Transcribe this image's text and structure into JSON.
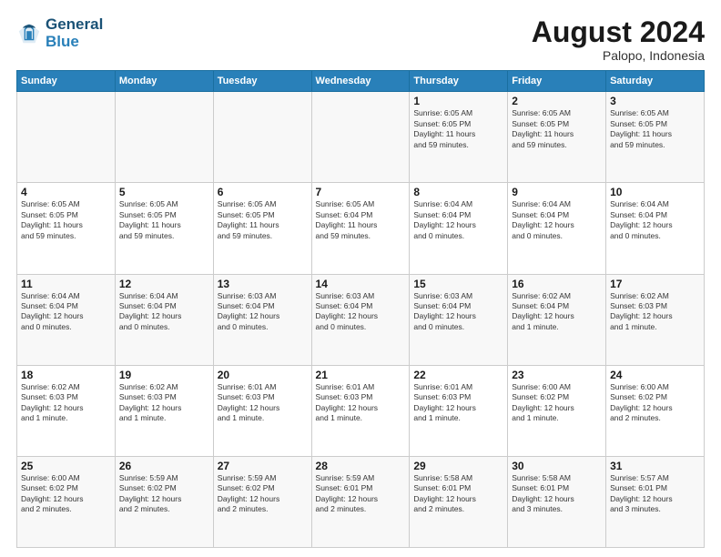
{
  "header": {
    "logo_line1": "General",
    "logo_line2": "Blue",
    "main_title": "August 2024",
    "subtitle": "Palopo, Indonesia"
  },
  "calendar": {
    "days_of_week": [
      "Sunday",
      "Monday",
      "Tuesday",
      "Wednesday",
      "Thursday",
      "Friday",
      "Saturday"
    ],
    "weeks": [
      [
        {
          "day": "",
          "info": ""
        },
        {
          "day": "",
          "info": ""
        },
        {
          "day": "",
          "info": ""
        },
        {
          "day": "",
          "info": ""
        },
        {
          "day": "1",
          "info": "Sunrise: 6:05 AM\nSunset: 6:05 PM\nDaylight: 11 hours\nand 59 minutes."
        },
        {
          "day": "2",
          "info": "Sunrise: 6:05 AM\nSunset: 6:05 PM\nDaylight: 11 hours\nand 59 minutes."
        },
        {
          "day": "3",
          "info": "Sunrise: 6:05 AM\nSunset: 6:05 PM\nDaylight: 11 hours\nand 59 minutes."
        }
      ],
      [
        {
          "day": "4",
          "info": "Sunrise: 6:05 AM\nSunset: 6:05 PM\nDaylight: 11 hours\nand 59 minutes."
        },
        {
          "day": "5",
          "info": "Sunrise: 6:05 AM\nSunset: 6:05 PM\nDaylight: 11 hours\nand 59 minutes."
        },
        {
          "day": "6",
          "info": "Sunrise: 6:05 AM\nSunset: 6:05 PM\nDaylight: 11 hours\nand 59 minutes."
        },
        {
          "day": "7",
          "info": "Sunrise: 6:05 AM\nSunset: 6:04 PM\nDaylight: 11 hours\nand 59 minutes."
        },
        {
          "day": "8",
          "info": "Sunrise: 6:04 AM\nSunset: 6:04 PM\nDaylight: 12 hours\nand 0 minutes."
        },
        {
          "day": "9",
          "info": "Sunrise: 6:04 AM\nSunset: 6:04 PM\nDaylight: 12 hours\nand 0 minutes."
        },
        {
          "day": "10",
          "info": "Sunrise: 6:04 AM\nSunset: 6:04 PM\nDaylight: 12 hours\nand 0 minutes."
        }
      ],
      [
        {
          "day": "11",
          "info": "Sunrise: 6:04 AM\nSunset: 6:04 PM\nDaylight: 12 hours\nand 0 minutes."
        },
        {
          "day": "12",
          "info": "Sunrise: 6:04 AM\nSunset: 6:04 PM\nDaylight: 12 hours\nand 0 minutes."
        },
        {
          "day": "13",
          "info": "Sunrise: 6:03 AM\nSunset: 6:04 PM\nDaylight: 12 hours\nand 0 minutes."
        },
        {
          "day": "14",
          "info": "Sunrise: 6:03 AM\nSunset: 6:04 PM\nDaylight: 12 hours\nand 0 minutes."
        },
        {
          "day": "15",
          "info": "Sunrise: 6:03 AM\nSunset: 6:04 PM\nDaylight: 12 hours\nand 0 minutes."
        },
        {
          "day": "16",
          "info": "Sunrise: 6:02 AM\nSunset: 6:04 PM\nDaylight: 12 hours\nand 1 minute."
        },
        {
          "day": "17",
          "info": "Sunrise: 6:02 AM\nSunset: 6:03 PM\nDaylight: 12 hours\nand 1 minute."
        }
      ],
      [
        {
          "day": "18",
          "info": "Sunrise: 6:02 AM\nSunset: 6:03 PM\nDaylight: 12 hours\nand 1 minute."
        },
        {
          "day": "19",
          "info": "Sunrise: 6:02 AM\nSunset: 6:03 PM\nDaylight: 12 hours\nand 1 minute."
        },
        {
          "day": "20",
          "info": "Sunrise: 6:01 AM\nSunset: 6:03 PM\nDaylight: 12 hours\nand 1 minute."
        },
        {
          "day": "21",
          "info": "Sunrise: 6:01 AM\nSunset: 6:03 PM\nDaylight: 12 hours\nand 1 minute."
        },
        {
          "day": "22",
          "info": "Sunrise: 6:01 AM\nSunset: 6:03 PM\nDaylight: 12 hours\nand 1 minute."
        },
        {
          "day": "23",
          "info": "Sunrise: 6:00 AM\nSunset: 6:02 PM\nDaylight: 12 hours\nand 1 minute."
        },
        {
          "day": "24",
          "info": "Sunrise: 6:00 AM\nSunset: 6:02 PM\nDaylight: 12 hours\nand 2 minutes."
        }
      ],
      [
        {
          "day": "25",
          "info": "Sunrise: 6:00 AM\nSunset: 6:02 PM\nDaylight: 12 hours\nand 2 minutes."
        },
        {
          "day": "26",
          "info": "Sunrise: 5:59 AM\nSunset: 6:02 PM\nDaylight: 12 hours\nand 2 minutes."
        },
        {
          "day": "27",
          "info": "Sunrise: 5:59 AM\nSunset: 6:02 PM\nDaylight: 12 hours\nand 2 minutes."
        },
        {
          "day": "28",
          "info": "Sunrise: 5:59 AM\nSunset: 6:01 PM\nDaylight: 12 hours\nand 2 minutes."
        },
        {
          "day": "29",
          "info": "Sunrise: 5:58 AM\nSunset: 6:01 PM\nDaylight: 12 hours\nand 2 minutes."
        },
        {
          "day": "30",
          "info": "Sunrise: 5:58 AM\nSunset: 6:01 PM\nDaylight: 12 hours\nand 3 minutes."
        },
        {
          "day": "31",
          "info": "Sunrise: 5:57 AM\nSunset: 6:01 PM\nDaylight: 12 hours\nand 3 minutes."
        }
      ]
    ]
  }
}
